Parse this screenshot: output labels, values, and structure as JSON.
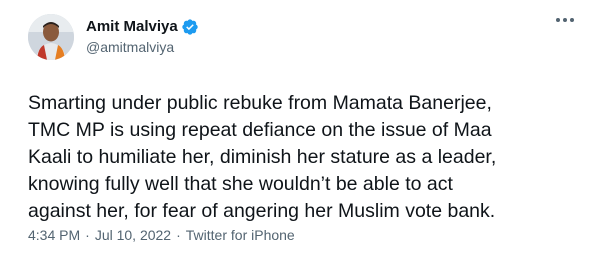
{
  "author": {
    "display_name": "Amit Malviya",
    "handle": "@amitmalviya",
    "verified": true
  },
  "tweet": {
    "text": "Smarting under public rebuke from Mamata Banerjee,\nTMC MP is using repeat defiance on the issue of Maa\nKaali to humiliate her, diminish her stature as a leader,\nknowing fully well that she wouldn’t be able to act\nagainst her, for fear of angering her Muslim vote bank.",
    "time": "4:34 PM",
    "date": "Jul 10, 2022",
    "source": "Twitter for iPhone",
    "separator": "·"
  },
  "colors": {
    "text": "#0f1419",
    "secondary": "#536471",
    "verified": "#1d9bf0"
  },
  "icons": {
    "verified": "verified-badge-icon",
    "more": "more-options-icon"
  }
}
